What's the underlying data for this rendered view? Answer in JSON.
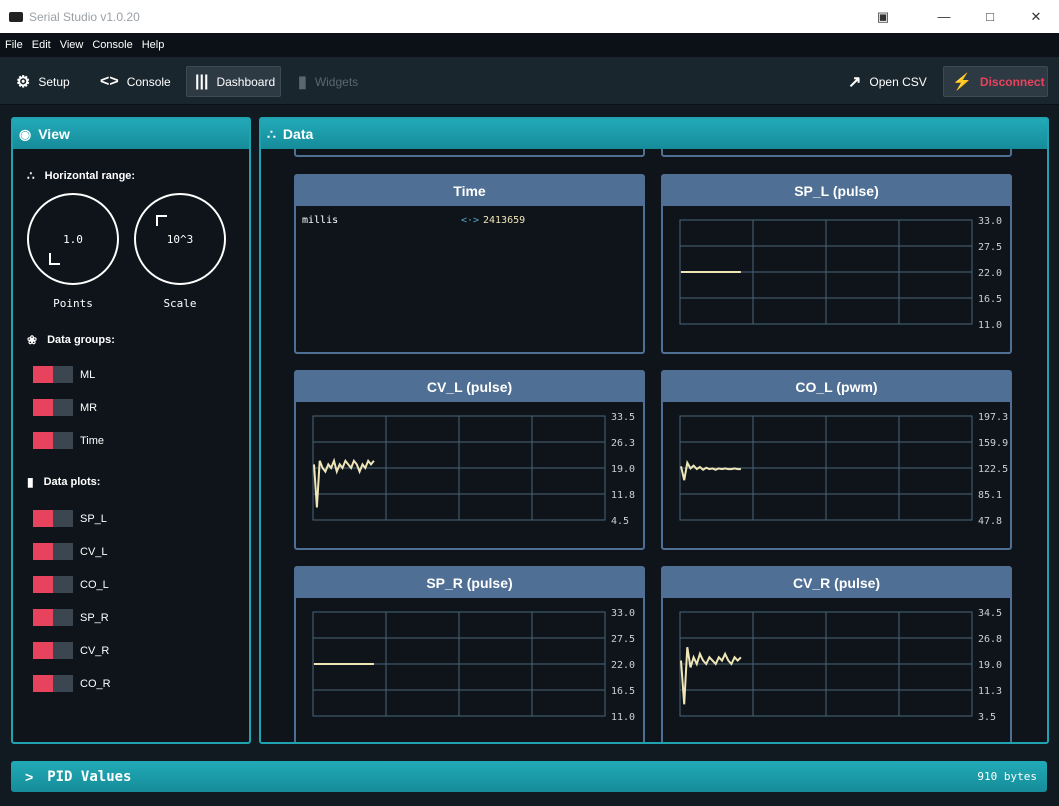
{
  "window": {
    "title": "Serial Studio v1.0.20"
  },
  "menu": [
    "File",
    "Edit",
    "View",
    "Console",
    "Help"
  ],
  "toolbar": {
    "setup": "Setup",
    "console": "Console",
    "dashboard": "Dashboard",
    "widgets": "Widgets",
    "open_csv": "Open CSV",
    "disconnect": "Disconnect"
  },
  "view": {
    "title": "View",
    "horizontal_range": "Horizontal range:",
    "points_value": "1.0",
    "points_label": "Points",
    "scale_value": "10^3",
    "scale_label": "Scale",
    "data_groups_title": "Data groups:",
    "groups": [
      "ML",
      "MR",
      "Time"
    ],
    "data_plots_title": "Data plots:",
    "plots": [
      "SP_L",
      "CV_L",
      "CO_L",
      "SP_R",
      "CV_R",
      "CO_R"
    ]
  },
  "data_panel": {
    "title": "Data"
  },
  "time_widget": {
    "title": "Time",
    "key": "millis",
    "arrow": "<·>",
    "value": "2413659"
  },
  "colors": {
    "accent": "#20a2b0",
    "widget_header": "#4f6f94",
    "toggle_on": "#e8435d",
    "trace": "#efe6b8"
  },
  "chart_data": [
    {
      "type": "line",
      "title": "SP_L (pulse)",
      "y_ticks": [
        "33.0",
        "27.5",
        "22.0",
        "16.5",
        "11.0"
      ],
      "ylim": [
        11.0,
        33.0
      ],
      "series": [
        {
          "values": [
            22,
            22,
            22,
            22,
            22,
            22,
            22,
            22,
            22,
            22
          ]
        }
      ]
    },
    {
      "type": "line",
      "title": "CV_L (pulse)",
      "y_ticks": [
        "33.5",
        "26.3",
        "19.0",
        "11.8",
        "4.5"
      ],
      "ylim": [
        4.5,
        33.5
      ],
      "series": [
        {
          "values": [
            20,
            8,
            21,
            19,
            18,
            20,
            19,
            21,
            18,
            20,
            19,
            21,
            20,
            19,
            21,
            20,
            18,
            20,
            19,
            21,
            20,
            21
          ]
        }
      ]
    },
    {
      "type": "line",
      "title": "CO_L (pwm)",
      "y_ticks": [
        "197.3",
        "159.9",
        "122.5",
        "85.1",
        "47.8"
      ],
      "ylim": [
        47.8,
        197.3
      ],
      "series": [
        {
          "values": [
            125,
            105,
            130,
            122,
            126,
            121,
            124,
            120,
            123,
            121,
            122,
            120,
            122,
            121,
            122,
            121,
            121,
            122,
            121,
            121
          ]
        }
      ]
    },
    {
      "type": "line",
      "title": "SP_R (pulse)",
      "y_ticks": [
        "33.0",
        "27.5",
        "22.0",
        "16.5",
        "11.0"
      ],
      "ylim": [
        11.0,
        33.0
      ],
      "series": [
        {
          "values": [
            22,
            22,
            22,
            22,
            22,
            22,
            22,
            22,
            22,
            22
          ]
        }
      ]
    },
    {
      "type": "line",
      "title": "CV_R (pulse)",
      "y_ticks": [
        "34.5",
        "26.8",
        "19.0",
        "11.3",
        "3.5"
      ],
      "ylim": [
        3.5,
        34.5
      ],
      "series": [
        {
          "values": [
            20,
            7,
            24,
            18,
            21,
            19,
            22,
            20,
            19,
            21,
            20,
            19,
            21,
            20,
            22,
            20,
            19,
            21,
            20,
            21
          ]
        }
      ]
    }
  ],
  "bottom": {
    "title": "PID Values",
    "bytes": "910 bytes"
  }
}
